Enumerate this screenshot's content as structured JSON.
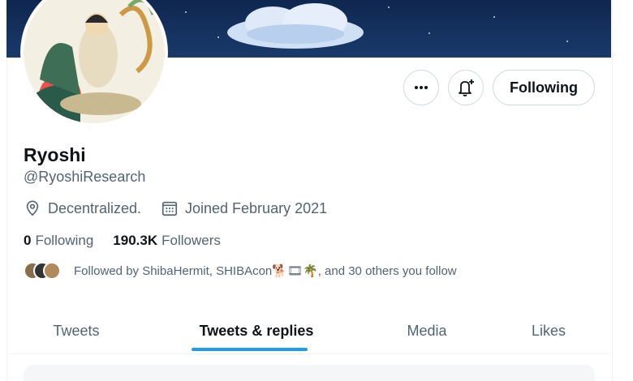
{
  "profile": {
    "name": "Ryoshi",
    "handle": "@RyoshiResearch",
    "location": "Decentralized.",
    "joined": "Joined February 2021"
  },
  "actions": {
    "follow_label": "Following",
    "more_icon": "more-icon",
    "notify_icon": "bell-plus-icon"
  },
  "counts": {
    "following_value": "0",
    "following_label": "Following",
    "followers_value": "190.3K",
    "followers_label": "Followers"
  },
  "followed_by": {
    "prefix": "Followed by ShibaHermit, SHIBAcon",
    "suffix": ", and 30 others you follow",
    "emoji": "🐕🎞🌴"
  },
  "tabs": [
    {
      "label": "Tweets"
    },
    {
      "label": "Tweets & replies"
    },
    {
      "label": "Media"
    },
    {
      "label": "Likes"
    }
  ],
  "colors": {
    "accent": "#1d9bf0",
    "banner": "#0f2750",
    "secondary_text": "#536471"
  }
}
